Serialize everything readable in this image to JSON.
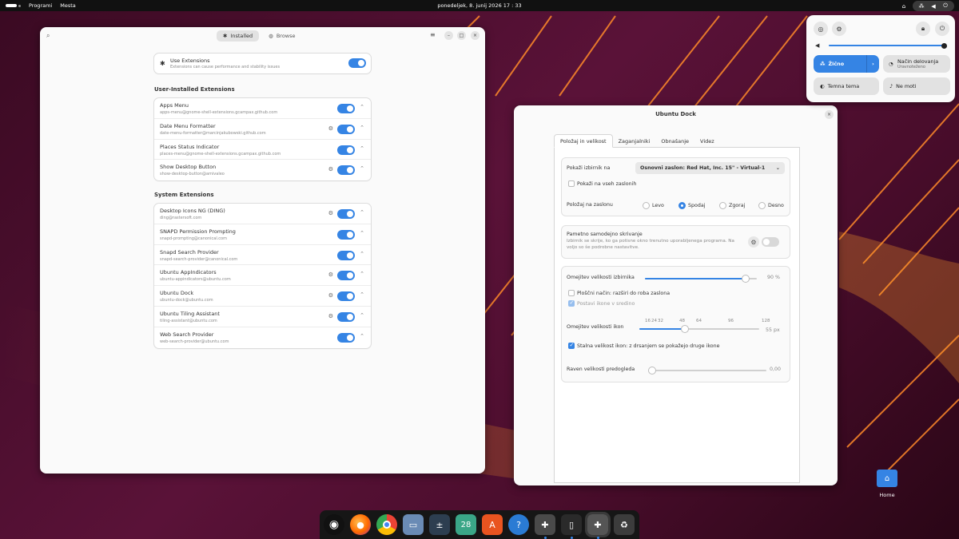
{
  "topbar": {
    "programs": "Programi",
    "places": "Mesta",
    "clock": "ponedeljek, 8. junij 2026  17 : 33"
  },
  "extensions_window": {
    "tab_installed": "Installed",
    "tab_browse": "Browse",
    "use_extensions": {
      "title": "Use Extensions",
      "subtitle": "Extensions can cause performance and stability issues",
      "enabled": true
    },
    "user_section": "User-Installed Extensions",
    "user_extensions": [
      {
        "name": "Apps Menu",
        "id": "apps-menu@gnome-shell-extensions.gcampax.github.com",
        "settings": false,
        "enabled": true
      },
      {
        "name": "Date Menu Formatter",
        "id": "date-menu-formatter@marcinjakubowski.github.com",
        "settings": true,
        "enabled": true
      },
      {
        "name": "Places Status Indicator",
        "id": "places-menu@gnome-shell-extensions.gcampax.github.com",
        "settings": false,
        "enabled": true
      },
      {
        "name": "Show Desktop Button",
        "id": "show-desktop-button@amivaleo",
        "settings": true,
        "enabled": true
      }
    ],
    "system_section": "System Extensions",
    "system_extensions": [
      {
        "name": "Desktop Icons NG (DING)",
        "id": "ding@rastersoft.com",
        "settings": true,
        "enabled": true
      },
      {
        "name": "SNAPD Permission Prompting",
        "id": "snapd-prompting@canonical.com",
        "settings": false,
        "enabled": true
      },
      {
        "name": "Snapd Search Provider",
        "id": "snapd-search-provider@canonical.com",
        "settings": false,
        "enabled": true
      },
      {
        "name": "Ubuntu AppIndicators",
        "id": "ubuntu-appindicators@ubuntu.com",
        "settings": true,
        "enabled": true
      },
      {
        "name": "Ubuntu Dock",
        "id": "ubuntu-dock@ubuntu.com",
        "settings": true,
        "enabled": true
      },
      {
        "name": "Ubuntu Tiling Assistant",
        "id": "tiling-assistant@ubuntu.com",
        "settings": true,
        "enabled": true
      },
      {
        "name": "Web Search Provider",
        "id": "web-search-provider@ubuntu.com",
        "settings": false,
        "enabled": true
      }
    ]
  },
  "dock_window": {
    "title": "Ubuntu Dock",
    "tabs": [
      "Položaj in velikost",
      "Zaganjalniki",
      "Obnašanje",
      "Videz"
    ],
    "show_on_label": "Pokaži izbirnik na",
    "show_on_value": "Osnovni zaslon: Red Hat, Inc. 15\" - Virtual-1",
    "all_monitors": "Pokaži na vseh zaslonih",
    "position_label": "Položaj na zaslonu",
    "positions": [
      "Levo",
      "Spodaj",
      "Zgoraj",
      "Desno"
    ],
    "selected_position": "Spodaj",
    "autohide_title": "Pametno samodejno skrivanje",
    "autohide_desc": "Izbirnik se skrije, ko ga potisne okno trenutno uporabljenega programa. Na voljo so še podrobne nastavitve.",
    "autohide_enabled": false,
    "dock_size_label": "Omejitev velikosti izbirnika",
    "dock_size_value": "90 %",
    "dock_size_fraction": 0.9,
    "panel_mode": "Ploščni način: razširi do roba zaslona",
    "center_icons": "Postavi ikone v sredino",
    "icon_size_label": "Omejitev velikosti ikon",
    "icon_size_ticks": [
      "16",
      "24",
      "32",
      "48",
      "64",
      "96",
      "128"
    ],
    "icon_size_value": "55 px",
    "fixed_icon_size": "Stalna velikost ikon: z drsanjem se pokažejo druge ikone",
    "preview_size_label": "Raven velikosti predogleda",
    "preview_size_value": "0,00"
  },
  "quick_settings": {
    "volume": 1.0,
    "network_label": "Žično",
    "power_mode_label": "Način delovanja",
    "power_mode_value": "Uravnoteženo",
    "dark_theme": "Temna tema",
    "dnd": "Ne moti"
  },
  "taskbar": {
    "apps": [
      "ubuntu-icon",
      "firefox-icon",
      "chrome-icon",
      "files-icon",
      "calculator-icon",
      "calendar-icon",
      "app-center-icon",
      "help-icon",
      "extensions-icon",
      "usb-icon",
      "extensions-active-icon",
      "trash-icon"
    ],
    "calendar_day": "28"
  },
  "desktop": {
    "home_label": "Home"
  },
  "colors": {
    "accent": "#3584e4",
    "topbar": "#111111",
    "wallpaper": "#4a0d2c"
  }
}
